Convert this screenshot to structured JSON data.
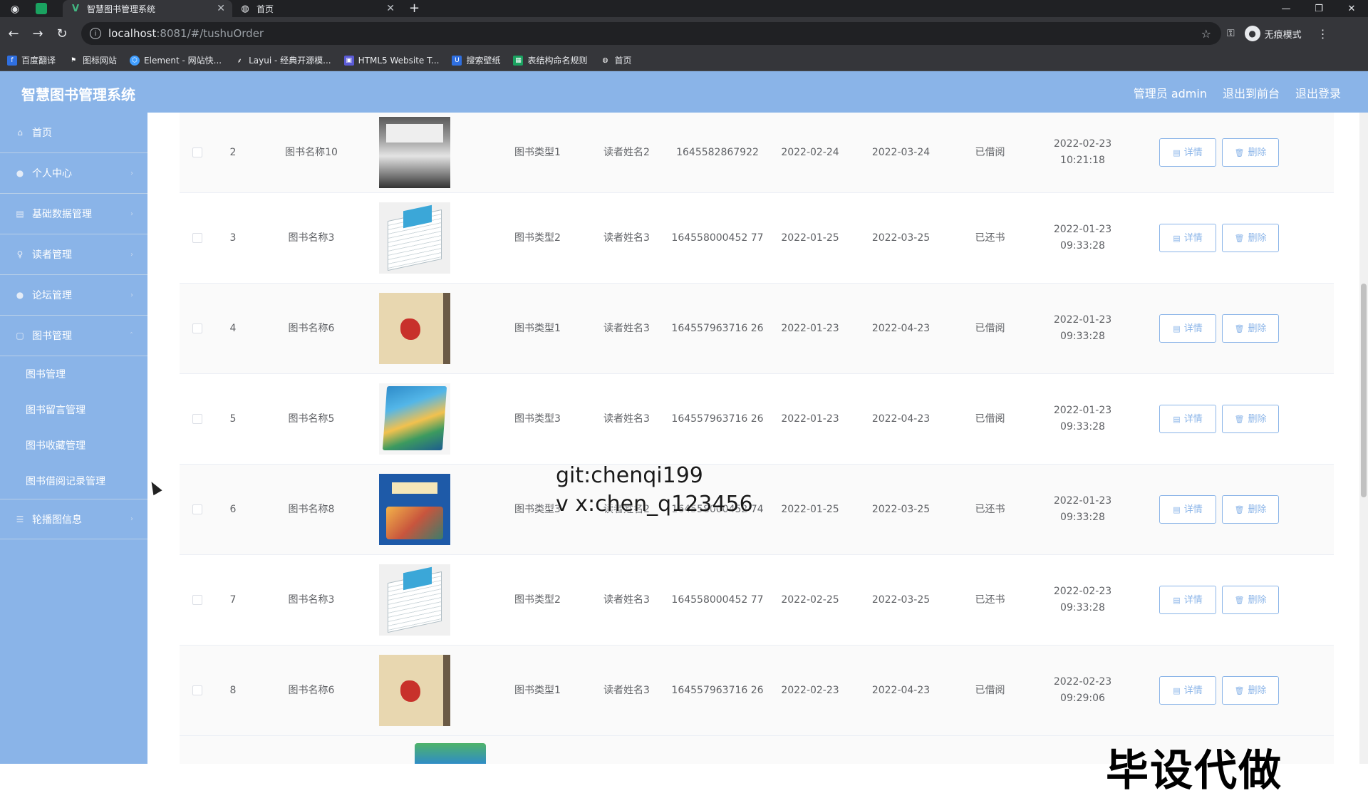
{
  "browser": {
    "tabs": [
      {
        "title": "智慧图书管理系统",
        "active": true
      },
      {
        "title": "首页",
        "active": false
      }
    ],
    "url_host": "localhost",
    "url_rest": ":8081/#/tushuOrder",
    "incognito_label": "无痕模式",
    "bookmarks": [
      "百度翻译",
      "图标网站",
      "Element - 网站快...",
      "Layui - 经典开源模...",
      "HTML5 Website T...",
      "搜索壁纸",
      "表结构命名规则",
      "首页"
    ]
  },
  "app": {
    "title": "智慧图书管理系统",
    "header_links": [
      "管理员 admin",
      "退出到前台",
      "退出登录"
    ]
  },
  "sidebar": {
    "items": [
      {
        "label": "首页",
        "icon": "home-icon"
      },
      {
        "label": "个人中心",
        "icon": "user-icon"
      },
      {
        "label": "基础数据管理",
        "icon": "data-icon"
      },
      {
        "label": "读者管理",
        "icon": "reader-icon"
      },
      {
        "label": "论坛管理",
        "icon": "forum-icon"
      },
      {
        "label": "图书管理",
        "icon": "book-icon"
      }
    ],
    "subitems": [
      "图书管理",
      "图书留言管理",
      "图书收藏管理",
      "图书借阅记录管理"
    ],
    "last_item": {
      "label": "轮播图信息",
      "icon": "list-icon"
    }
  },
  "table": {
    "detail_label": "详情",
    "delete_label": "删除",
    "rows": [
      {
        "idx": "2",
        "name": "图书名称10",
        "type": "图书类型1",
        "reader": "读者姓名2",
        "num": "1645582867922",
        "start": "2022-02-24",
        "end": "2022-03-24",
        "status": "已借阅",
        "time": "2022-02-23 10:21:18"
      },
      {
        "idx": "3",
        "name": "图书名称3",
        "type": "图书类型2",
        "reader": "读者姓名3",
        "num": "164558000452 77",
        "start": "2022-01-25",
        "end": "2022-03-25",
        "status": "已还书",
        "time": "2022-01-23 09:33:28"
      },
      {
        "idx": "4",
        "name": "图书名称6",
        "type": "图书类型1",
        "reader": "读者姓名3",
        "num": "164557963716 26",
        "start": "2022-01-23",
        "end": "2022-04-23",
        "status": "已借阅",
        "time": "2022-01-23 09:33:28"
      },
      {
        "idx": "5",
        "name": "图书名称5",
        "type": "图书类型3",
        "reader": "读者姓名3",
        "num": "164557963716 26",
        "start": "2022-01-23",
        "end": "2022-04-23",
        "status": "已借阅",
        "time": "2022-01-23 09:33:28"
      },
      {
        "idx": "6",
        "name": "图书名称8",
        "type": "图书类型3",
        "reader": "读者姓名2",
        "num": "164558000452 74",
        "start": "2022-01-25",
        "end": "2022-03-25",
        "status": "已还书",
        "time": "2022-01-23 09:33:28"
      },
      {
        "idx": "7",
        "name": "图书名称3",
        "type": "图书类型2",
        "reader": "读者姓名3",
        "num": "164558000452 77",
        "start": "2022-02-25",
        "end": "2022-03-25",
        "status": "已还书",
        "time": "2022-02-23 09:33:28"
      },
      {
        "idx": "8",
        "name": "图书名称6",
        "type": "图书类型1",
        "reader": "读者姓名3",
        "num": "164557963716 26",
        "start": "2022-02-23",
        "end": "2022-04-23",
        "status": "已借阅",
        "time": "2022-02-23 09:29:06"
      }
    ]
  },
  "watermarks": {
    "line1": "git:chenqi199",
    "line2": "v x:chen_q123456",
    "corner": "毕设代做"
  }
}
